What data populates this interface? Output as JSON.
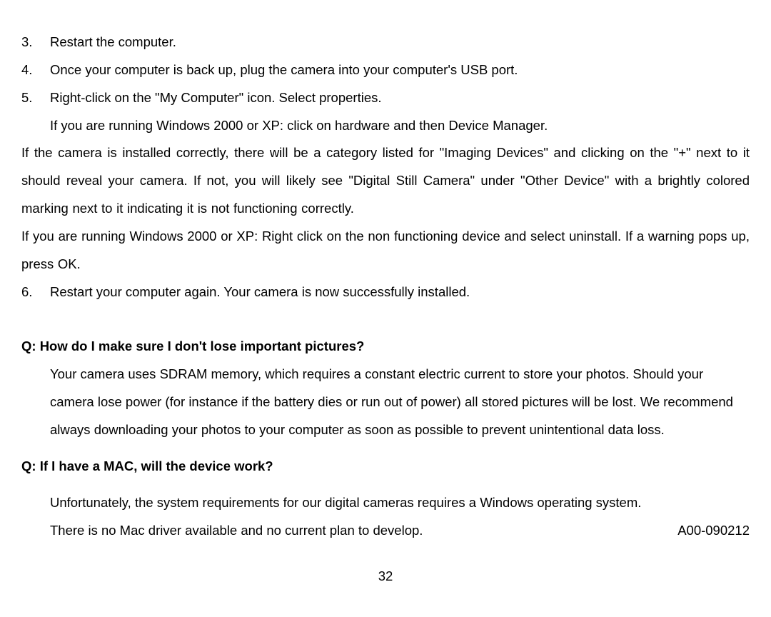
{
  "steps": {
    "s3_num": "3.",
    "s3_text": "Restart the computer.",
    "s4_num": "4.",
    "s4_text": "Once your computer is back up, plug the camera into your computer's USB port.",
    "s5_num": "5.",
    "s5_text": "Right-click on the \"My Computer\" icon. Select properties.",
    "s5_sub": "If you are running Windows 2000 or XP: click on hardware and then Device Manager.",
    "para1": "If the camera is installed correctly, there will be a category listed for \"Imaging Devices\" and clicking on the \"+\" next to it should reveal your camera. If not, you will likely see \"Digital Still Camera\" under \"Other Device\" with a brightly colored marking next to it indicating it is not functioning correctly.",
    "para2": "If you are running Windows 2000 or XP: Right click on the non functioning device and select uninstall. If a warning pops up, press OK.",
    "s6_num": "6.",
    "s6_text": "Restart your computer again. Your camera is now successfully installed."
  },
  "qa1": {
    "q": "Q: How do I make sure I don't lose important pictures?",
    "a": "Your camera uses SDRAM memory, which requires a constant electric current to store your photos. Should your camera lose power (for instance if the battery dies or run out of power) all stored pictures will be lost. We recommend always downloading your photos to your computer as soon as possible to prevent unintentional data loss."
  },
  "qa2": {
    "q": "Q: If I have a MAC, will the device work?",
    "a_line1": "Unfortunately, the system requirements for our digital cameras requires a Windows operating system.",
    "a_line2": "There is no Mac driver available and no current plan to develop.",
    "code": "A00-090212"
  },
  "page_number": "32"
}
